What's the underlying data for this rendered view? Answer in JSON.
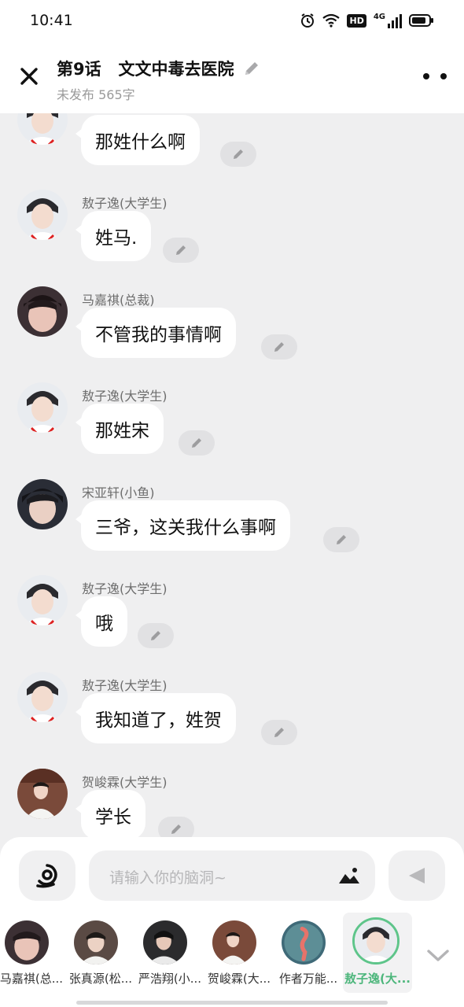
{
  "status_bar": {
    "time": "10:41",
    "icons": [
      "alarm-icon",
      "wifi-icon",
      "hd-icon",
      "signal-4g-icon",
      "battery-icon"
    ],
    "network_label": "4G",
    "hd_label": "HD"
  },
  "header": {
    "title": "第9话   文文中毒去医院",
    "subtitle": "未发布 565字",
    "icons": [
      "close-icon",
      "pencil-icon",
      "more-icon"
    ]
  },
  "messages": [
    {
      "name": "",
      "text": "那姓什么啊",
      "avatar_color": "#e9ecf0"
    },
    {
      "name": "敖子逸(大学生)",
      "text": "姓马.",
      "avatar_color": "#e9ecf0"
    },
    {
      "name": "马嘉祺(总裁)",
      "text": "不管我的事情啊",
      "avatar_color": "#3c3034"
    },
    {
      "name": "敖子逸(大学生)",
      "text": "那姓宋",
      "avatar_color": "#e9ecf0"
    },
    {
      "name": "宋亚轩(小鱼)",
      "text": "三爷，这关我什么事啊",
      "avatar_color": "#2a2d36"
    },
    {
      "name": "敖子逸(大学生)",
      "text": "哦",
      "avatar_color": "#e9ecf0"
    },
    {
      "name": "敖子逸(大学生)",
      "text": "我知道了，姓贺",
      "avatar_color": "#e9ecf0"
    },
    {
      "name": "贺峻霖(大学生)",
      "text": "学长",
      "avatar_color": "#7a4a3a"
    }
  ],
  "composer": {
    "placeholder": "请输入你的脑洞~",
    "icons": [
      "voice-icon",
      "image-icon",
      "send-icon"
    ]
  },
  "characters": [
    {
      "label": "马嘉祺(总...",
      "selected": false,
      "avatar_color": "#3c3034"
    },
    {
      "label": "张真源(松...",
      "selected": false,
      "avatar_color": "#5a4a44"
    },
    {
      "label": "严浩翔(小...",
      "selected": false,
      "avatar_color": "#2b2b2d"
    },
    {
      "label": "贺峻霖(大...",
      "selected": false,
      "avatar_color": "#7a4a3a"
    },
    {
      "label": "作者万能...",
      "selected": false,
      "avatar_color": "#3f6a78"
    },
    {
      "label": "敖子逸(大...",
      "selected": true,
      "avatar_color": "#e9ecf0"
    }
  ],
  "colors": {
    "background": "#efeff0",
    "bubble": "#ffffff",
    "accent_green": "#5ec58a"
  }
}
